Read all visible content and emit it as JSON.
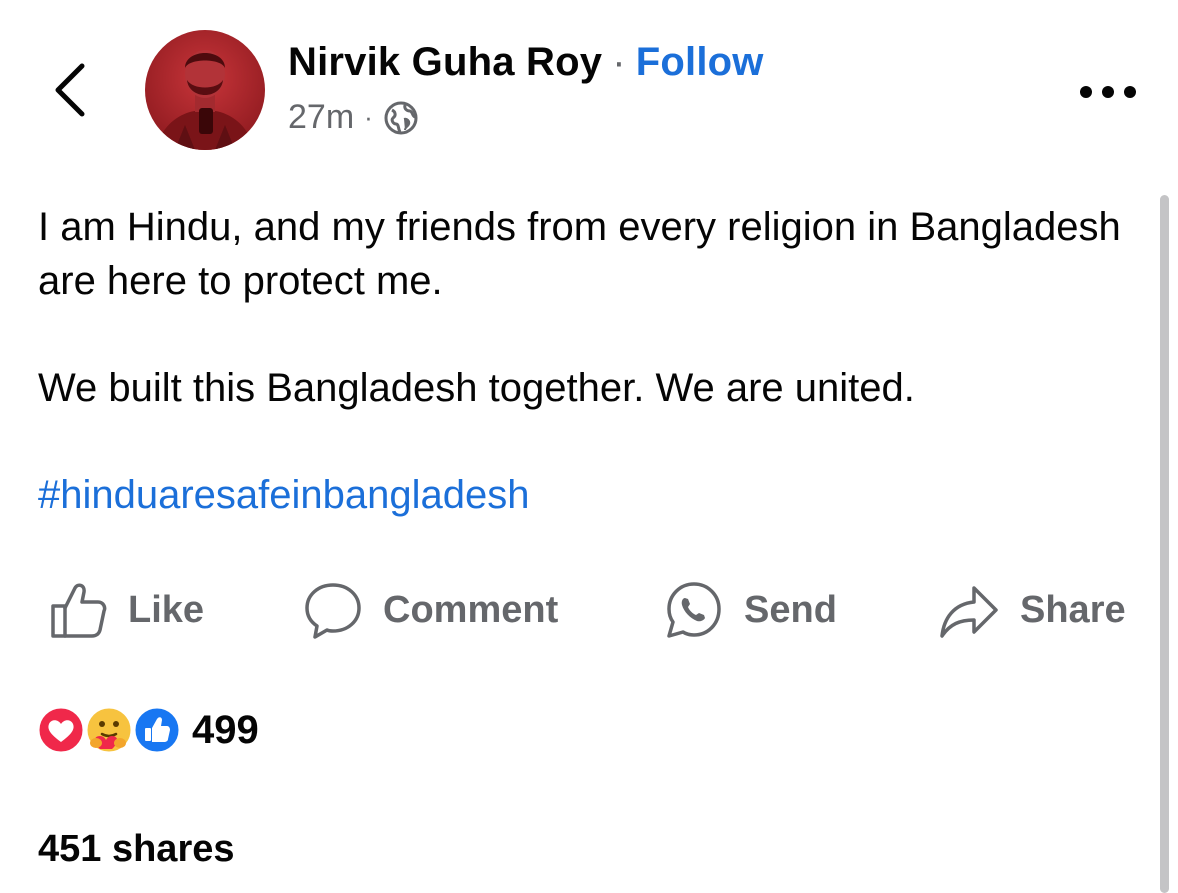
{
  "header": {
    "author_name": "Nirvik Guha Roy",
    "separator": "·",
    "follow_label": "Follow",
    "timestamp": "27m",
    "meta_separator": "·",
    "audience_icon": "globe-icon"
  },
  "post": {
    "paragraphs": [
      "I am Hindu, and my friends from every religion in Bangladesh are here to protect me.",
      "We built this Bangladesh together. We are united."
    ],
    "hashtag": "#hinduaresafeinbangladesh"
  },
  "actions": {
    "like_label": "Like",
    "comment_label": "Comment",
    "send_label": "Send",
    "share_label": "Share"
  },
  "stats": {
    "reaction_icons": [
      "love-icon",
      "care-icon",
      "like-icon"
    ],
    "reaction_count": "499",
    "shares_text": "451 shares"
  },
  "colors": {
    "link_blue": "#1b6fd9",
    "secondary_text": "#65676b",
    "love_red": "#f0284a",
    "like_blue": "#1877f2",
    "care_yellow": "#f7c33f",
    "avatar_red": "#b3262b"
  }
}
